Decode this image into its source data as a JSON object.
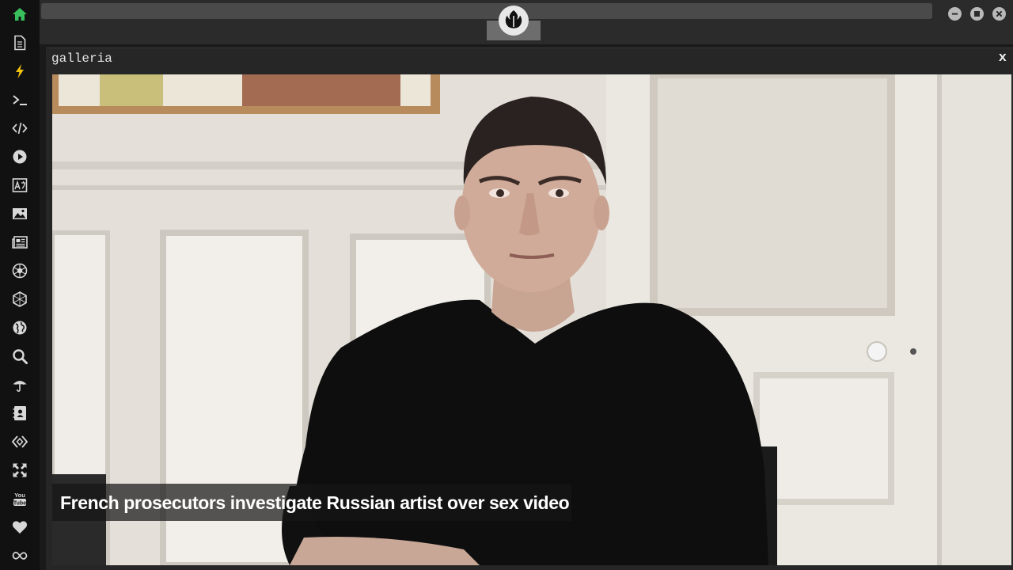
{
  "sidebar": {
    "items": [
      {
        "icon": "home-icon",
        "color": "#39c05c"
      },
      {
        "icon": "document-icon",
        "color": "#d8d8d8"
      },
      {
        "icon": "lightning-icon",
        "color": "#f2c40f"
      },
      {
        "icon": "terminal-icon",
        "color": "#d8d8d8"
      },
      {
        "icon": "code-icon",
        "color": "#d8d8d8"
      },
      {
        "icon": "play-icon",
        "color": "#d8d8d8"
      },
      {
        "icon": "translate-icon",
        "color": "#d8d8d8"
      },
      {
        "icon": "image-icon",
        "color": "#d8d8d8"
      },
      {
        "icon": "newspaper-icon",
        "color": "#d8d8d8"
      },
      {
        "icon": "rebel-icon",
        "color": "#d8d8d8"
      },
      {
        "icon": "hexagon-icon",
        "color": "#d8d8d8"
      },
      {
        "icon": "globe-icon",
        "color": "#d8d8d8"
      },
      {
        "icon": "search-icon",
        "color": "#d8d8d8"
      },
      {
        "icon": "umbrella-icon",
        "color": "#d8d8d8"
      },
      {
        "icon": "contacts-icon",
        "color": "#d8d8d8"
      },
      {
        "icon": "diamond-code-icon",
        "color": "#d8d8d8"
      },
      {
        "icon": "expand-icon",
        "color": "#d8d8d8"
      },
      {
        "icon": "youtube-icon",
        "color": "#d8d8d8"
      },
      {
        "icon": "heart-icon",
        "color": "#d8d8d8"
      },
      {
        "icon": "infinity-icon",
        "color": "#d8d8d8"
      }
    ]
  },
  "topbar": {
    "logo_icon": "rebel-alliance-icon",
    "window_controls": [
      "minimize-icon",
      "maximize-icon",
      "close-icon"
    ]
  },
  "window": {
    "title": "galleria",
    "close_label": "x"
  },
  "gallery": {
    "caption": "French prosecutors investigate Russian artist over sex video"
  }
}
